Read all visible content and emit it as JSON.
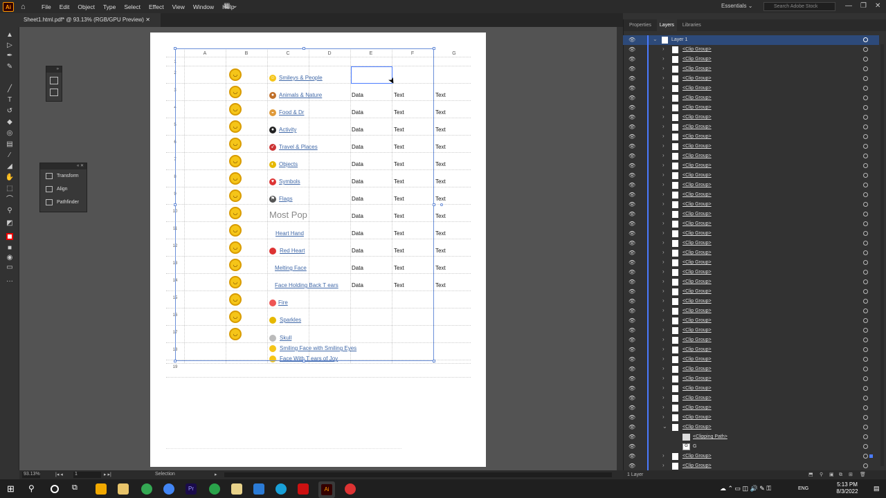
{
  "menubar": {
    "items": [
      "File",
      "Edit",
      "Object",
      "Type",
      "Select",
      "Effect",
      "View",
      "Window",
      "Help"
    ],
    "workspace": "Essentials",
    "search_placeholder": "Search Adobe Stock"
  },
  "document": {
    "tab_title": "Sheet1.html.pdf* @ 93.13% (RGB/GPU Preview)"
  },
  "float_panel": {
    "items": [
      "Transform",
      "Align",
      "Pathfinder"
    ]
  },
  "right_panel": {
    "tabs": [
      "Properties",
      "Layers",
      "Libraries"
    ],
    "layer_name": "Layer 1",
    "clip_group": "<Clip Group>",
    "clipping_path": "<Clipping Path>",
    "g_item": "G",
    "footer": "1 Layer"
  },
  "status": {
    "zoom": "93.13%",
    "artboard": "1",
    "tool": "Selection"
  },
  "taskbar": {
    "lang": "ENG",
    "time": "5:13 PM",
    "date": "8/3/2022"
  },
  "sheet": {
    "columns": [
      "A",
      "B",
      "C",
      "D",
      "E",
      "F",
      "G"
    ],
    "rows": [
      "1",
      "2",
      "3",
      "4",
      "5",
      "6",
      "7",
      "8",
      "9",
      "10",
      "11",
      "12",
      "13",
      "14",
      "15",
      "16",
      "17",
      "18",
      "19"
    ],
    "categories": [
      "Smileys & People",
      "Animals & Nature",
      "Food & Dr",
      "Activity",
      "Travel & Places",
      "Objects",
      "Symbols",
      "Flags"
    ],
    "most_pop": "Most Pop",
    "popular": [
      "Heart Hand",
      "Red Heart",
      "Melting Face",
      "Face Holding Back T    ears",
      "Fire",
      "Sparkles",
      "Skull",
      "Smiling Face with Smiling Eyes",
      "Face With T   ears of Joy"
    ],
    "data_label": "Data",
    "text_label": "Text"
  }
}
